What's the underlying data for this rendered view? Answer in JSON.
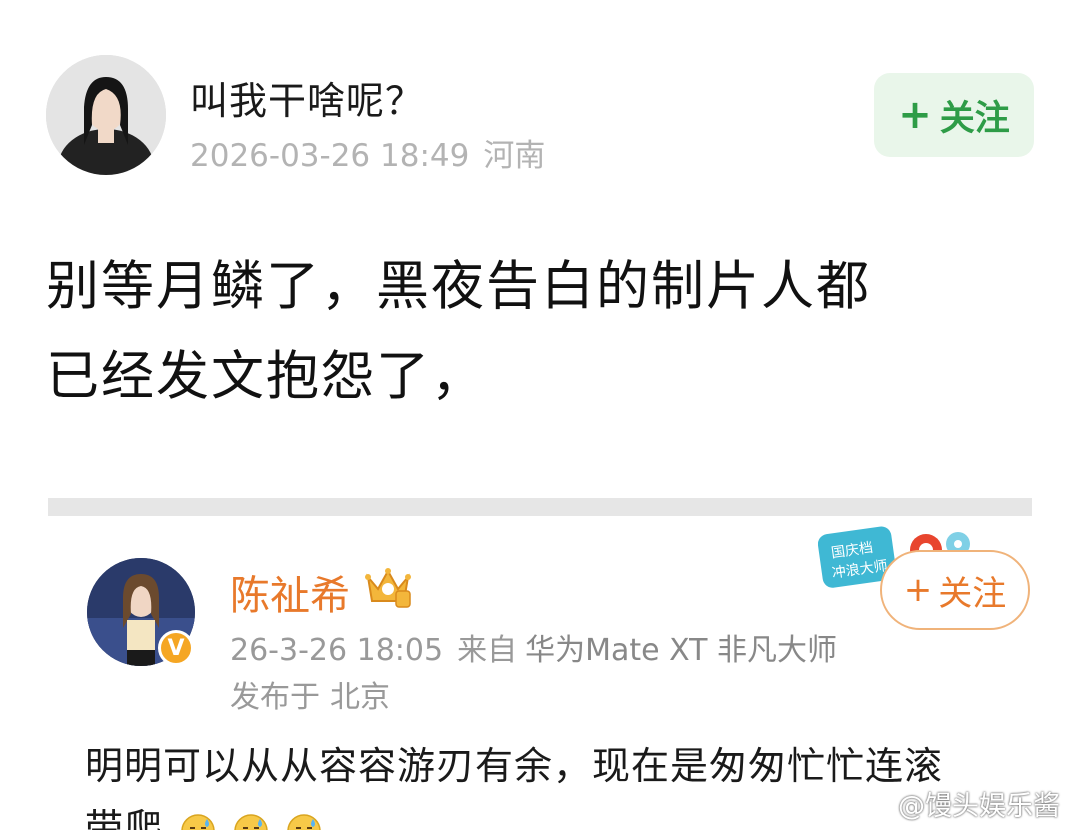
{
  "header": {
    "username": "叫我干啥呢？",
    "timestamp": "2026-03-26 18:49",
    "location": "河南",
    "follow_label": "关注",
    "follow_plus": "+"
  },
  "post": {
    "lines": [
      "别等月鳞了，黑夜告白的制片人都",
      "已经发文抱怨了，"
    ]
  },
  "embedded": {
    "username": "陈祉希",
    "timestamp": "26-3-26 18:05",
    "source_prefix": "来自",
    "device": "华为Mate XT 非凡大师",
    "location_prefix": "发布于",
    "location": "北京",
    "follow_label": "关注",
    "follow_plus": "+",
    "verified_mark": "V",
    "event_badge_text": [
      "国庆档",
      "冲浪大师"
    ],
    "text_lines": [
      "明明可以从从容容游刃有余，现在是匆匆忙忙连滚",
      "带爬"
    ],
    "emoji_icon": "sweat-smile-icon",
    "emoji_count": 3
  },
  "watermark": {
    "text": "@馒头娱乐酱"
  },
  "colors": {
    "follow_green": "#2e9c47",
    "follow_green_bg": "#e9f6ea",
    "orange_name": "#e8792b",
    "meta_gray": "#b3b3b3"
  }
}
